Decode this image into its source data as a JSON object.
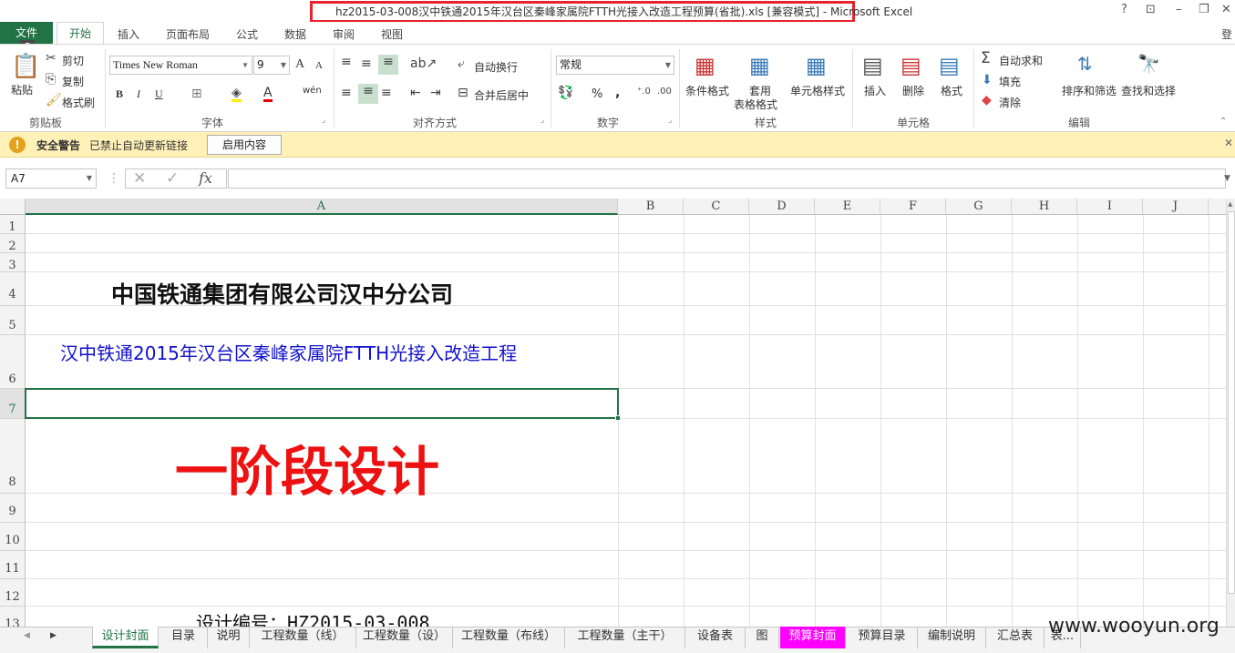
{
  "window": {
    "title": "hz2015-03-008汉中铁通2015年汉台区秦峰家属院FTTH光接入改造工程预算(省批).xls  [兼容模式] - Microsoft Excel",
    "help": "?",
    "restore": "⊡",
    "minimize": "–",
    "maximize": "❐",
    "close": "✕",
    "login": "登"
  },
  "tabs": {
    "file": "文件",
    "home": "开始",
    "insert": "插入",
    "layout": "页面布局",
    "formulas": "公式",
    "data": "数据",
    "review": "审阅",
    "view": "视图",
    "keytip": "F"
  },
  "ribbon": {
    "clipboard": {
      "paste": "粘贴",
      "cut": "剪切",
      "copy": "复制",
      "painter": "格式刷",
      "label": "剪贴板"
    },
    "font": {
      "name": "Times New Roman",
      "size": "9",
      "label": "字体",
      "bold": "B",
      "italic": "I",
      "underline": "U",
      "grow": "A",
      "shrink": "A",
      "wen": "wén"
    },
    "align": {
      "wrap": "自动换行",
      "merge": "合并后居中",
      "label": "对齐方式"
    },
    "number": {
      "format": "常规",
      "label": "数字",
      "pct": "%",
      "comma": ","
    },
    "styles": {
      "cond": "条件格式",
      "table1": "套用",
      "table2": "表格格式",
      "cell": "单元格样式",
      "label": "样式"
    },
    "cells": {
      "insert": "插入",
      "delete": "删除",
      "format": "格式",
      "label": "单元格"
    },
    "editing": {
      "autosum": "自动求和",
      "fill": "填充",
      "clear": "清除",
      "sort": "排序和筛选",
      "find": "查找和选择",
      "label": "编辑"
    }
  },
  "security": {
    "title": "安全警告",
    "message": "已禁止自动更新链接",
    "button": "启用内容"
  },
  "formula_bar": {
    "name_box": "A7",
    "fx": "fx",
    "value": ""
  },
  "columns": [
    "A",
    "B",
    "C",
    "D",
    "E",
    "F",
    "G",
    "H",
    "I",
    "J"
  ],
  "rows": [
    "1",
    "2",
    "3",
    "4",
    "5",
    "6",
    "7",
    "8",
    "9",
    "10",
    "11",
    "12",
    "13"
  ],
  "cells": {
    "company": "中国铁通集团有限公司汉中分公司",
    "project": "汉中铁通2015年汉台区秦峰家属院FTTH光接入改造工程",
    "phase": "一阶段设计",
    "design_no": "设计编号：HZ2015-03-008"
  },
  "sheets": [
    {
      "label": "设计封面",
      "active": true
    },
    {
      "label": "目录"
    },
    {
      "label": "说明"
    },
    {
      "label": "工程数量（线）"
    },
    {
      "label": "工程数量（设）"
    },
    {
      "label": "工程数量（布线）"
    },
    {
      "label": "工程数量（主干）"
    },
    {
      "label": "设备表"
    },
    {
      "label": "图"
    },
    {
      "label": "预算封面",
      "highlight": true
    },
    {
      "label": "预算目录"
    },
    {
      "label": "编制说明"
    },
    {
      "label": "汇总表"
    },
    {
      "label": "表..."
    }
  ],
  "watermark": "www.wooyun.org",
  "colors": {
    "excel_green": "#217346",
    "highlight_tab": "#ff00ff",
    "title_red": "#e8232e",
    "phase_red": "#ee1111",
    "project_blue": "#1010d0"
  }
}
